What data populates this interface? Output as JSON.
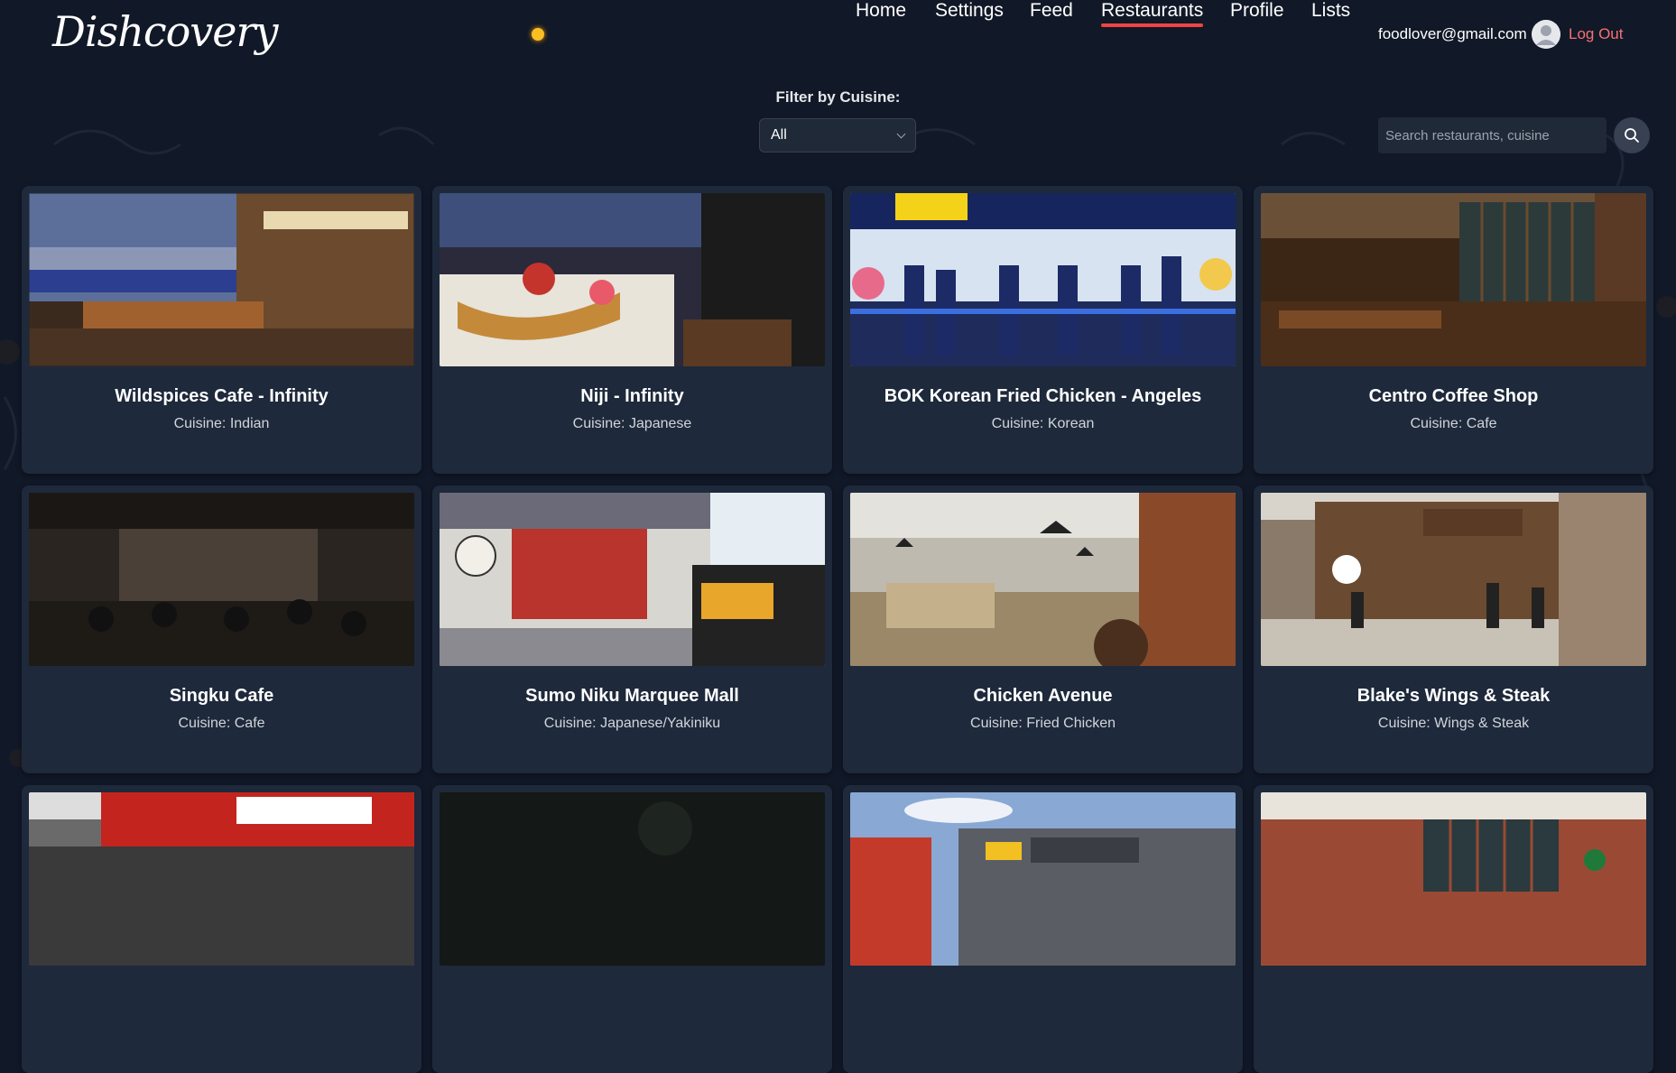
{
  "app": {
    "logo": "Dishcovery"
  },
  "nav": {
    "items": [
      {
        "label": "Home"
      },
      {
        "label": "Settings"
      },
      {
        "label": "Feed"
      },
      {
        "label": "Restaurants",
        "active": true
      },
      {
        "label": "Profile"
      },
      {
        "label": "Lists"
      }
    ],
    "user_email": "foodlover@gmail.com",
    "logout_label": "Log Out"
  },
  "filter": {
    "label": "Filter by Cuisine:",
    "selected": "All"
  },
  "search": {
    "placeholder": "Search restaurants, cuisine",
    "icon": "search-icon"
  },
  "cuisine_prefix": "Cuisine:",
  "restaurants": [
    {
      "name": "Wildspices Cafe - Infinity",
      "cuisine": "Indian"
    },
    {
      "name": "Niji - Infinity",
      "cuisine": "Japanese"
    },
    {
      "name": "BOK Korean Fried Chicken - Angeles",
      "cuisine": "Korean"
    },
    {
      "name": "Centro Coffee Shop",
      "cuisine": "Cafe"
    },
    {
      "name": "Singku Cafe",
      "cuisine": "Cafe"
    },
    {
      "name": "Sumo Niku Marquee Mall",
      "cuisine": "Japanese/Yakiniku"
    },
    {
      "name": "Chicken Avenue",
      "cuisine": "Fried Chicken"
    },
    {
      "name": "Blake's Wings & Steak",
      "cuisine": "Wings & Steak"
    },
    {
      "name": "",
      "cuisine": ""
    },
    {
      "name": "",
      "cuisine": ""
    },
    {
      "name": "",
      "cuisine": ""
    },
    {
      "name": "",
      "cuisine": ""
    }
  ],
  "colors": {
    "background": "#111827",
    "card": "#1e293b",
    "accent": "#ef4444",
    "logout": "#f87171",
    "theme_dot": "#fbbf24"
  }
}
